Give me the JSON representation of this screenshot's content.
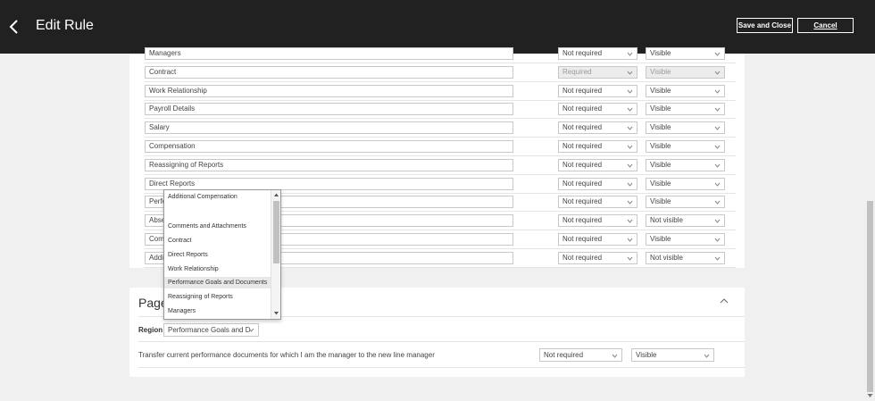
{
  "header": {
    "title": "Edit Rule",
    "save_close_label": "Save and Close",
    "cancel_label": "Cancel"
  },
  "rules": [
    {
      "name": "Managers",
      "required": "Not required",
      "visibility": "Visible",
      "disabled": false
    },
    {
      "name": "Contract",
      "required": "Required",
      "visibility": "Visible",
      "disabled": true
    },
    {
      "name": "Work Relationship",
      "required": "Not required",
      "visibility": "Visible",
      "disabled": false
    },
    {
      "name": "Payroll Details",
      "required": "Not required",
      "visibility": "Visible",
      "disabled": false
    },
    {
      "name": "Salary",
      "required": "Not required",
      "visibility": "Visible",
      "disabled": false
    },
    {
      "name": "Compensation",
      "required": "Not required",
      "visibility": "Visible",
      "disabled": false
    },
    {
      "name": "Reassigning of Reports",
      "required": "Not required",
      "visibility": "Visible",
      "disabled": false
    },
    {
      "name": "Direct Reports",
      "required": "Not required",
      "visibility": "Visible",
      "disabled": false
    },
    {
      "name": "Perfo",
      "required": "Not required",
      "visibility": "Visible",
      "disabled": false
    },
    {
      "name": "Abse",
      "required": "Not required",
      "visibility": "Not visible",
      "disabled": false
    },
    {
      "name": "Comi",
      "required": "Not required",
      "visibility": "Visible",
      "disabled": false
    },
    {
      "name": "Addi",
      "required": "Not required",
      "visibility": "Not visible",
      "disabled": false
    }
  ],
  "dropdown": {
    "items": [
      "Additional Compensation",
      "",
      "Comments and Attachments",
      "Contract",
      "Direct Reports",
      "Work Relationship",
      "Performance Goals and Documents",
      "Reassigning of Reports",
      "Managers"
    ],
    "highlighted": "Performance Goals and Documents"
  },
  "page_section": {
    "title": "Page",
    "region_label": "Region",
    "region_value": "Performance Goals and D",
    "transfer_text": "Transfer current performance documents for which I am the manager to the new line manager",
    "transfer_required": "Not required",
    "transfer_visibility": "Visible"
  },
  "icons": {
    "back": "chevron-left-icon",
    "select": "chevron-down-icon",
    "collapse": "chevron-up-icon"
  },
  "colors": {
    "topbar": "#212121",
    "card": "#ffffff",
    "background": "#f0f0f0",
    "highlight": "#e8e8e8"
  }
}
